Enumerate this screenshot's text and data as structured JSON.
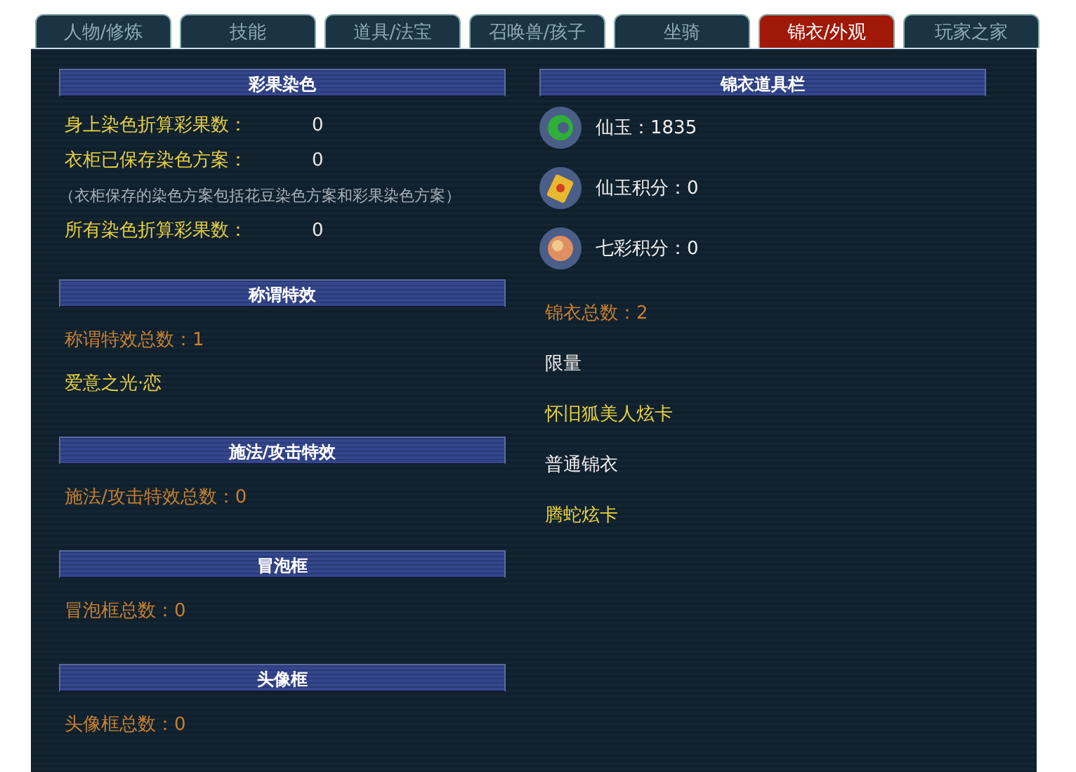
{
  "tabs": [
    {
      "label": "人物/修炼",
      "selected": false
    },
    {
      "label": "技能",
      "selected": false
    },
    {
      "label": "道具/法宝",
      "selected": false
    },
    {
      "label": "召唤兽/孩子",
      "selected": false
    },
    {
      "label": "坐骑",
      "selected": false
    },
    {
      "label": "锦衣/外观",
      "selected": true
    },
    {
      "label": "玩家之家",
      "selected": false
    }
  ],
  "left_sections": [
    {
      "title": "彩果染色",
      "lines": [
        {
          "kind": "stat",
          "label": "身上染色折算彩果数：",
          "value": "0"
        },
        {
          "kind": "stat",
          "label": "衣柜已保存染色方案：",
          "value": "0"
        },
        {
          "kind": "note",
          "label": "（衣柜保存的染色方案包括花豆染色方案和彩果染色方案）"
        },
        {
          "kind": "stat",
          "label": "所有染色折算彩果数：",
          "value": "0"
        }
      ]
    },
    {
      "title": "称谓特效",
      "lines": [
        {
          "kind": "total",
          "label": "称谓特效总数：1"
        },
        {
          "kind": "item",
          "label": "爱意之光·恋"
        }
      ]
    },
    {
      "title": "施法/攻击特效",
      "lines": [
        {
          "kind": "total",
          "label": "施法/攻击特效总数：0"
        }
      ]
    },
    {
      "title": "冒泡框",
      "lines": [
        {
          "kind": "total",
          "label": "冒泡框总数：0"
        }
      ]
    },
    {
      "title": "头像框",
      "lines": [
        {
          "kind": "total",
          "label": "头像框总数：0"
        }
      ]
    }
  ],
  "wardrobe": {
    "title": "锦衣道具栏",
    "currencies": [
      {
        "label": "仙玉：1835"
      },
      {
        "label": "仙玉积分：0"
      },
      {
        "label": "七彩积分：0"
      }
    ],
    "lines": [
      {
        "kind": "total",
        "label": "锦衣总数：2"
      },
      {
        "kind": "group",
        "label": "限量"
      },
      {
        "kind": "item",
        "label": "怀旧狐美人炫卡"
      },
      {
        "kind": "group",
        "label": "普通锦衣"
      },
      {
        "kind": "item",
        "label": "腾蛇炫卡"
      }
    ]
  }
}
